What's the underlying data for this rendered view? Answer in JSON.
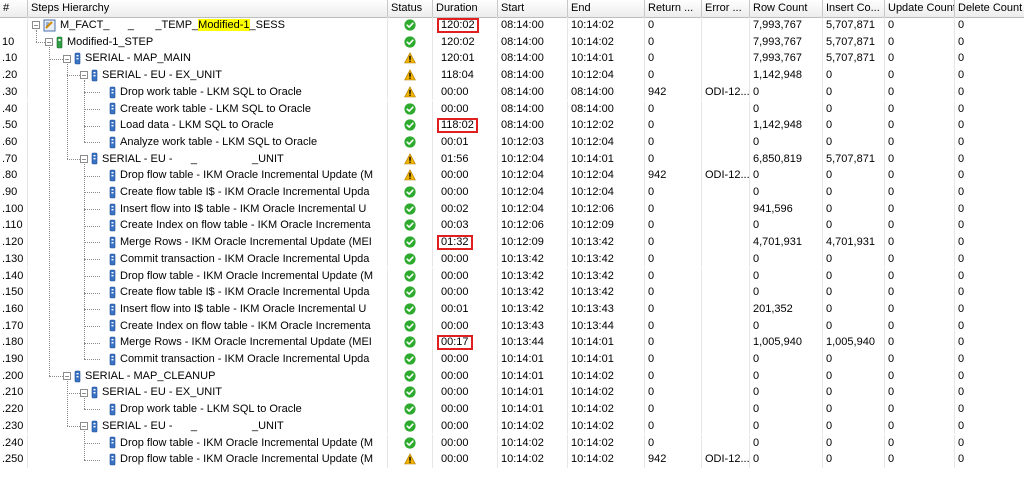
{
  "columns": {
    "num": "#",
    "hierarchy": "Steps Hierarchy",
    "status": "Status",
    "duration": "Duration",
    "start": "Start",
    "end": "End",
    "return_code": "Return ...",
    "error": "Error ...",
    "row_count": "Row Count",
    "insert_count": "Insert Co...",
    "update_count": "Update Count",
    "delete_count": "Delete Count"
  },
  "rows": [
    {
      "num": "",
      "level": 0,
      "kind": "session",
      "label_parts": [
        "M_FACT_      _       _TEMP_",
        "Modified-1",
        "_SESS"
      ],
      "status": "success",
      "duration": "120:02",
      "start": "08:14:00",
      "end": "10:14:02",
      "return_code": "0",
      "error": "",
      "row_count": "7,993,767",
      "insert_count": "5,707,871",
      "update_count": "0",
      "delete_count": "0",
      "expander": "−",
      "duration_boxed": true
    },
    {
      "num": "10",
      "level": 1,
      "kind": "step",
      "label": "Modified-1_STEP",
      "status": "success",
      "duration": "120:02",
      "start": "08:14:00",
      "end": "10:14:02",
      "return_code": "0",
      "error": "",
      "row_count": "7,993,767",
      "insert_count": "5,707,871",
      "update_count": "0",
      "delete_count": "0",
      "expander": "−"
    },
    {
      "num": ".10",
      "level": 2,
      "kind": "task",
      "label": "SERIAL - MAP_MAIN",
      "status": "warning",
      "duration": "120:01",
      "start": "08:14:00",
      "end": "10:14:01",
      "return_code": "0",
      "error": "",
      "row_count": "7,993,767",
      "insert_count": "5,707,871",
      "update_count": "0",
      "delete_count": "0",
      "expander": "−"
    },
    {
      "num": ".20",
      "level": 3,
      "kind": "task",
      "label": "SERIAL - EU - EX_UNIT",
      "status": "warning",
      "duration": "118:04",
      "start": "08:14:00",
      "end": "10:12:04",
      "return_code": "0",
      "error": "",
      "row_count": "1,142,948",
      "insert_count": "0",
      "update_count": "0",
      "delete_count": "0",
      "expander": "−"
    },
    {
      "num": ".30",
      "level": 4,
      "kind": "task",
      "label": "Drop work table - LKM SQL to Oracle",
      "status": "warning",
      "duration": "00:00",
      "start": "08:14:00",
      "end": "08:14:00",
      "return_code": "942",
      "error": "ODI-12...",
      "row_count": "0",
      "insert_count": "0",
      "update_count": "0",
      "delete_count": "0"
    },
    {
      "num": ".40",
      "level": 4,
      "kind": "task",
      "label": "Create work table - LKM SQL to Oracle",
      "status": "success",
      "duration": "00:00",
      "start": "08:14:00",
      "end": "08:14:00",
      "return_code": "0",
      "error": "",
      "row_count": "0",
      "insert_count": "0",
      "update_count": "0",
      "delete_count": "0"
    },
    {
      "num": ".50",
      "level": 4,
      "kind": "task",
      "label": "Load data - LKM SQL to Oracle",
      "status": "success",
      "duration": "118:02",
      "start": "08:14:00",
      "end": "10:12:02",
      "return_code": "0",
      "error": "",
      "row_count": "1,142,948",
      "insert_count": "0",
      "update_count": "0",
      "delete_count": "0",
      "duration_boxed": true
    },
    {
      "num": ".60",
      "level": 4,
      "kind": "task",
      "label": "Analyze work table - LKM SQL to Oracle",
      "status": "success",
      "duration": "00:01",
      "start": "10:12:03",
      "end": "10:12:04",
      "return_code": "0",
      "error": "",
      "row_count": "0",
      "insert_count": "0",
      "update_count": "0",
      "delete_count": "0"
    },
    {
      "num": ".70",
      "level": 3,
      "kind": "task",
      "label": "SERIAL - EU -      _                  _UNIT",
      "status": "warning",
      "duration": "01:56",
      "start": "10:12:04",
      "end": "10:14:01",
      "return_code": "0",
      "error": "",
      "row_count": "6,850,819",
      "insert_count": "5,707,871",
      "update_count": "0",
      "delete_count": "0",
      "expander": "−"
    },
    {
      "num": ".80",
      "level": 4,
      "kind": "task",
      "label": "Drop flow table - IKM Oracle Incremental Update (M",
      "status": "warning",
      "duration": "00:00",
      "start": "10:12:04",
      "end": "10:12:04",
      "return_code": "942",
      "error": "ODI-12...",
      "row_count": "0",
      "insert_count": "0",
      "update_count": "0",
      "delete_count": "0"
    },
    {
      "num": ".90",
      "level": 4,
      "kind": "task",
      "label": "Create flow table I$ - IKM Oracle Incremental Upda",
      "status": "success",
      "duration": "00:00",
      "start": "10:12:04",
      "end": "10:12:04",
      "return_code": "0",
      "error": "",
      "row_count": "0",
      "insert_count": "0",
      "update_count": "0",
      "delete_count": "0"
    },
    {
      "num": ".100",
      "level": 4,
      "kind": "task",
      "label": "Insert flow into I$ table - IKM Oracle Incremental U",
      "status": "success",
      "duration": "00:02",
      "start": "10:12:04",
      "end": "10:12:06",
      "return_code": "0",
      "error": "",
      "row_count": "941,596",
      "insert_count": "0",
      "update_count": "0",
      "delete_count": "0"
    },
    {
      "num": ".110",
      "level": 4,
      "kind": "task",
      "label": "Create Index on flow table - IKM Oracle Incrementa",
      "status": "success",
      "duration": "00:03",
      "start": "10:12:06",
      "end": "10:12:09",
      "return_code": "0",
      "error": "",
      "row_count": "0",
      "insert_count": "0",
      "update_count": "0",
      "delete_count": "0"
    },
    {
      "num": ".120",
      "level": 4,
      "kind": "task",
      "label": "Merge Rows - IKM Oracle Incremental Update (MEI",
      "status": "success",
      "duration": "01:32",
      "start": "10:12:09",
      "end": "10:13:42",
      "return_code": "0",
      "error": "",
      "row_count": "4,701,931",
      "insert_count": "4,701,931",
      "update_count": "0",
      "delete_count": "0",
      "duration_boxed": true
    },
    {
      "num": ".130",
      "level": 4,
      "kind": "task",
      "label": "Commit transaction - IKM Oracle Incremental Upda",
      "status": "success",
      "duration": "00:00",
      "start": "10:13:42",
      "end": "10:13:42",
      "return_code": "0",
      "error": "",
      "row_count": "0",
      "insert_count": "0",
      "update_count": "0",
      "delete_count": "0"
    },
    {
      "num": ".140",
      "level": 4,
      "kind": "task",
      "label": "Drop flow table - IKM Oracle Incremental Update (M",
      "status": "success",
      "duration": "00:00",
      "start": "10:13:42",
      "end": "10:13:42",
      "return_code": "0",
      "error": "",
      "row_count": "0",
      "insert_count": "0",
      "update_count": "0",
      "delete_count": "0"
    },
    {
      "num": ".150",
      "level": 4,
      "kind": "task",
      "label": "Create flow table I$ - IKM Oracle Incremental Upda",
      "status": "success",
      "duration": "00:00",
      "start": "10:13:42",
      "end": "10:13:42",
      "return_code": "0",
      "error": "",
      "row_count": "0",
      "insert_count": "0",
      "update_count": "0",
      "delete_count": "0"
    },
    {
      "num": ".160",
      "level": 4,
      "kind": "task",
      "label": "Insert flow into I$ table - IKM Oracle Incremental U",
      "status": "success",
      "duration": "00:01",
      "start": "10:13:42",
      "end": "10:13:43",
      "return_code": "0",
      "error": "",
      "row_count": "201,352",
      "insert_count": "0",
      "update_count": "0",
      "delete_count": "0"
    },
    {
      "num": ".170",
      "level": 4,
      "kind": "task",
      "label": "Create Index on flow table - IKM Oracle Incrementa",
      "status": "success",
      "duration": "00:00",
      "start": "10:13:43",
      "end": "10:13:44",
      "return_code": "0",
      "error": "",
      "row_count": "0",
      "insert_count": "0",
      "update_count": "0",
      "delete_count": "0"
    },
    {
      "num": ".180",
      "level": 4,
      "kind": "task",
      "label": "Merge Rows - IKM Oracle Incremental Update (MEI",
      "status": "success",
      "duration": "00:17",
      "start": "10:13:44",
      "end": "10:14:01",
      "return_code": "0",
      "error": "",
      "row_count": "1,005,940",
      "insert_count": "1,005,940",
      "update_count": "0",
      "delete_count": "0",
      "duration_boxed": true
    },
    {
      "num": ".190",
      "level": 4,
      "kind": "task",
      "label": "Commit transaction - IKM Oracle Incremental Upda",
      "status": "success",
      "duration": "00:00",
      "start": "10:14:01",
      "end": "10:14:01",
      "return_code": "0",
      "error": "",
      "row_count": "0",
      "insert_count": "0",
      "update_count": "0",
      "delete_count": "0"
    },
    {
      "num": ".200",
      "level": 2,
      "kind": "task",
      "label": "SERIAL - MAP_CLEANUP",
      "status": "success",
      "duration": "00:00",
      "start": "10:14:01",
      "end": "10:14:02",
      "return_code": "0",
      "error": "",
      "row_count": "0",
      "insert_count": "0",
      "update_count": "0",
      "delete_count": "0",
      "expander": "−"
    },
    {
      "num": ".210",
      "level": 3,
      "kind": "task",
      "label": "SERIAL - EU - EX_UNIT",
      "status": "success",
      "duration": "00:00",
      "start": "10:14:01",
      "end": "10:14:02",
      "return_code": "0",
      "error": "",
      "row_count": "0",
      "insert_count": "0",
      "update_count": "0",
      "delete_count": "0",
      "expander": "−"
    },
    {
      "num": ".220",
      "level": 4,
      "kind": "task",
      "label": "Drop work table - LKM SQL to Oracle",
      "status": "success",
      "duration": "00:00",
      "start": "10:14:01",
      "end": "10:14:02",
      "return_code": "0",
      "error": "",
      "row_count": "0",
      "insert_count": "0",
      "update_count": "0",
      "delete_count": "0"
    },
    {
      "num": ".230",
      "level": 3,
      "kind": "task",
      "label": "SERIAL - EU -      _                  _UNIT",
      "status": "success",
      "duration": "00:00",
      "start": "10:14:02",
      "end": "10:14:02",
      "return_code": "0",
      "error": "",
      "row_count": "0",
      "insert_count": "0",
      "update_count": "0",
      "delete_count": "0",
      "expander": "−"
    },
    {
      "num": ".240",
      "level": 4,
      "kind": "task",
      "label": "Drop flow table - IKM Oracle Incremental Update (M",
      "status": "success",
      "duration": "00:00",
      "start": "10:14:02",
      "end": "10:14:02",
      "return_code": "0",
      "error": "",
      "row_count": "0",
      "insert_count": "0",
      "update_count": "0",
      "delete_count": "0"
    },
    {
      "num": ".250",
      "level": 4,
      "kind": "task",
      "label": "Drop flow table - IKM Oracle Incremental Update (M",
      "status": "warning",
      "duration": "00:00",
      "start": "10:14:02",
      "end": "10:14:02",
      "return_code": "942",
      "error": "ODI-12...",
      "row_count": "0",
      "insert_count": "0",
      "update_count": "0",
      "delete_count": "0"
    }
  ],
  "colors": {
    "success": "#2eaa2e",
    "warning": "#f0b400",
    "highlight": "#ffff00",
    "box": "#e02020"
  },
  "icons": {
    "success": "check-circle-icon",
    "warning": "warning-triangle-icon",
    "session": "session-icon",
    "step": "step-icon",
    "task": "task-icon"
  }
}
